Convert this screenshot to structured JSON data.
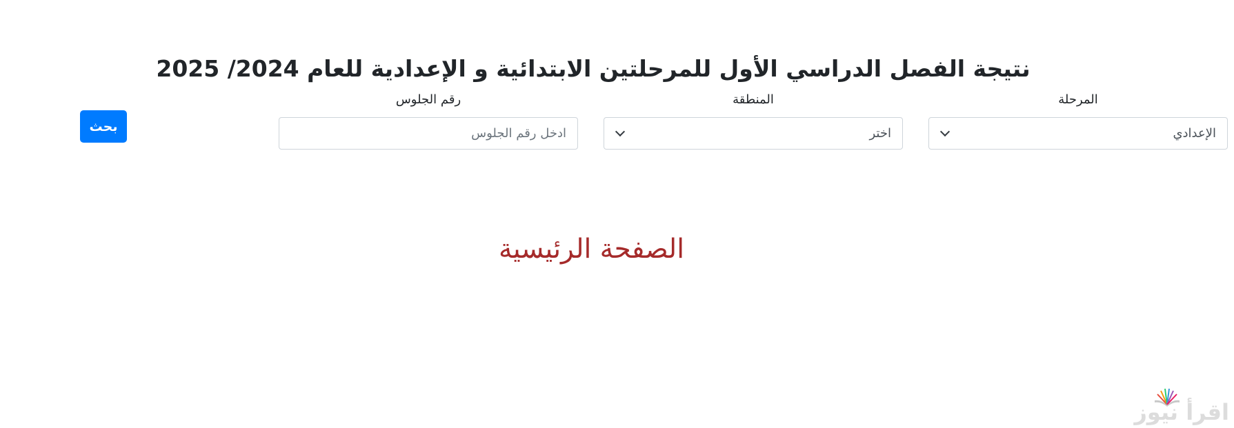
{
  "page": {
    "title": "نتيجة الفصل الدراسي الأول للمرحلتين الابتدائية و الإعدادية للعام 2024/ 2025"
  },
  "form": {
    "stage": {
      "label": "المرحلة",
      "selected": "الإعدادي"
    },
    "region": {
      "label": "المنطقة",
      "selected": "اختر"
    },
    "seat_number": {
      "label": "رقم الجلوس",
      "value": "",
      "placeholder": "ادخل رقم الجلوس"
    },
    "search_label": "بحث"
  },
  "home_link": "الصفحة الرئيسية",
  "watermark": {
    "text": "اقرأ نيوز",
    "icon": "open-book-icon"
  },
  "colors": {
    "primary": "#007bff",
    "link": "#a52a2a",
    "text": "#212529",
    "watermark": "#dcdcdc"
  }
}
